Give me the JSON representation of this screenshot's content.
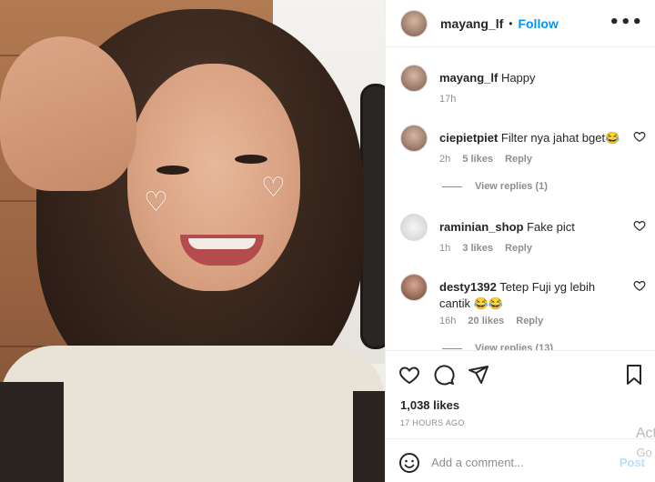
{
  "post_header": {
    "username": "mayang_lf",
    "separator": "•",
    "follow_label": "Follow",
    "more_icon": "more-horizontal-icon"
  },
  "caption": {
    "username": "mayang_lf",
    "text": "Happy",
    "time": "17h"
  },
  "comments": [
    {
      "username": "ciepietpiet",
      "text": "Filter nya jahat bget😂",
      "time": "2h",
      "likes": "5 likes",
      "reply_label": "Reply",
      "view_replies": "View replies (1)"
    },
    {
      "username": "raminian_shop",
      "text": "Fake pict",
      "time": "1h",
      "likes": "3 likes",
      "reply_label": "Reply"
    },
    {
      "username": "desty1392",
      "text": "Tetep Fuji yg lebih cantik 😂😂",
      "time": "16h",
      "likes": "20 likes",
      "reply_label": "Reply",
      "view_replies": "View replies (13)"
    }
  ],
  "actions": {
    "like_icon": "heart-icon",
    "comment_icon": "comment-icon",
    "share_icon": "send-icon",
    "save_icon": "bookmark-icon",
    "likes_count": "1,038 likes",
    "time_ago": "17 HOURS AGO"
  },
  "add_comment": {
    "emoji_icon": "emoji-icon",
    "placeholder": "Add a comment...",
    "post_label": "Post"
  },
  "watermark": {
    "line1": "Act",
    "line2": "Go t"
  },
  "photo": {
    "sticker": "♡"
  },
  "colors": {
    "accent": "#0095f6",
    "post_disabled": "#b2dffc",
    "muted": "#8e8e8e",
    "text": "#262626"
  }
}
